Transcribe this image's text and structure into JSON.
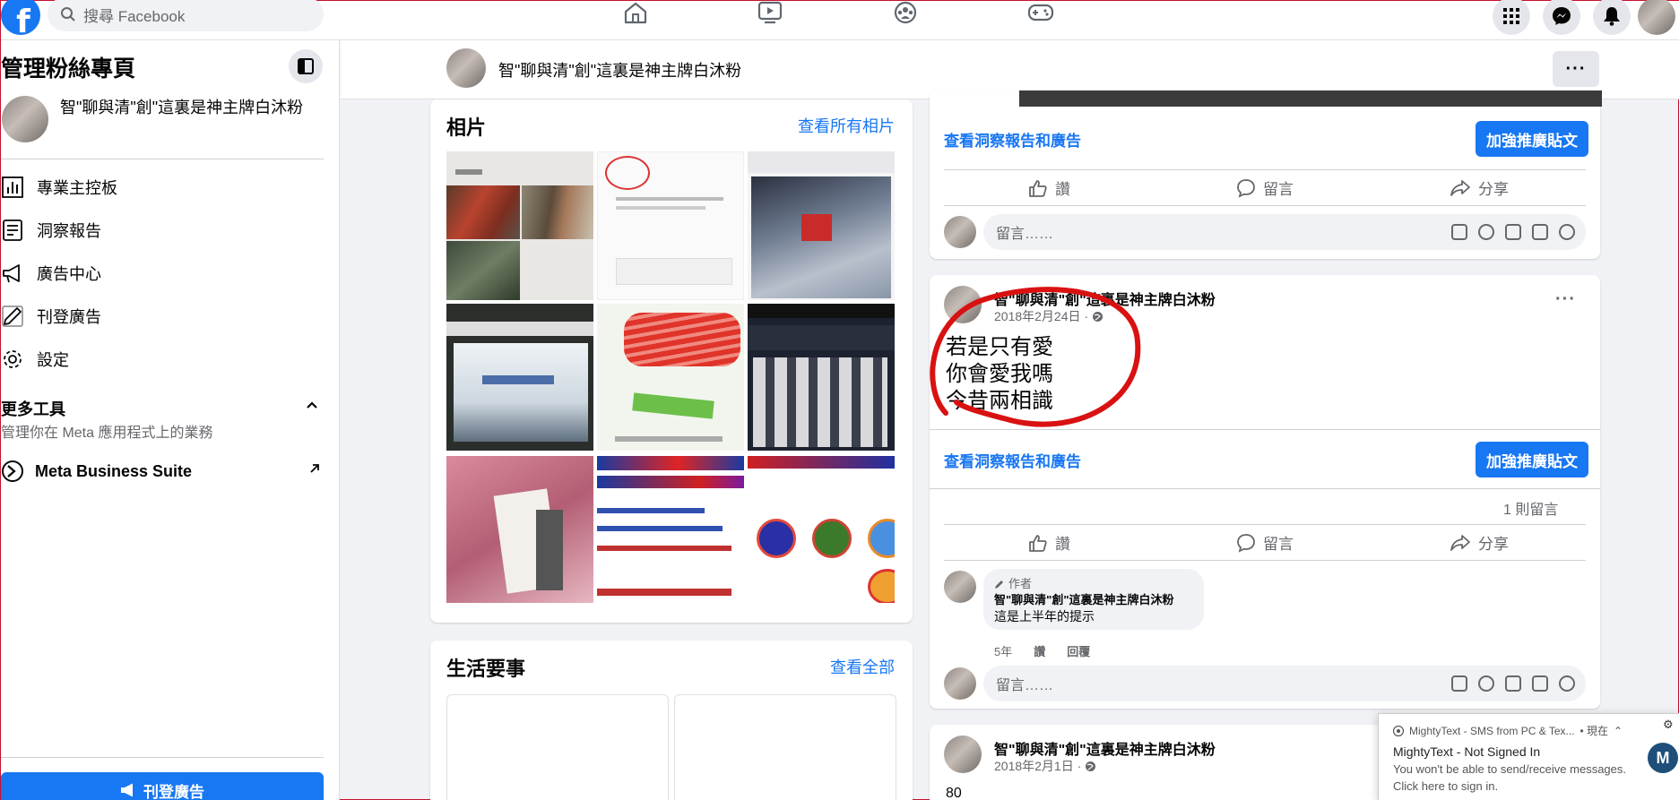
{
  "topbar": {
    "search_placeholder": "搜尋 Facebook"
  },
  "sidebar": {
    "title": "管理粉絲專頁",
    "page_name": "智\"聊與清\"創\"這裏是神主牌白沐粉",
    "items": [
      {
        "label": "專業主控板",
        "icon": "dashboard-icon"
      },
      {
        "label": "洞察報告",
        "icon": "insights-icon"
      },
      {
        "label": "廣告中心",
        "icon": "megaphone-icon"
      },
      {
        "label": "刊登廣告",
        "icon": "pencil-icon"
      },
      {
        "label": "設定",
        "icon": "gear-icon"
      }
    ],
    "more_tools": "更多工具",
    "more_tools_desc": "管理你在 Meta 應用程式上的業務",
    "meta_business_suite": "Meta Business Suite",
    "post_ad_button": "刊登廣告"
  },
  "page_header": {
    "name": "智\"聊與清\"創\"這裏是神主牌白沐粉",
    "more": "···"
  },
  "photos_card": {
    "title": "相片",
    "link": "查看所有相片"
  },
  "life_events_card": {
    "title": "生活要事",
    "link": "查看全部"
  },
  "post_actions": {
    "like": "讚",
    "comment": "留言",
    "share": "分享",
    "insights_link": "查看洞察報告和廣告",
    "boost_button": "加強推廣貼文",
    "comment_placeholder": "留言……"
  },
  "post1": {
    "author": "智\"聊與清\"創\"這裏是神主牌白沐粉",
    "date": "2018年2月24日 ·",
    "lines": [
      "若是只有愛",
      "你會愛我嗎",
      "今昔兩相識"
    ],
    "comment_count": "1 則留言",
    "comment": {
      "badge": "作者",
      "author": "智\"聊與清\"創\"這裏是神主牌白沐粉",
      "text": "這是上半年的提示",
      "time": "5年",
      "like": "讚",
      "reply": "回覆"
    }
  },
  "post2": {
    "author": "智\"聊與清\"創\"這裏是神主牌白沐粉",
    "date": "2018年2月1日 ·",
    "text": "80"
  },
  "popup": {
    "source": "MightyText - SMS from PC & Tex...",
    "time": "• 現在",
    "title": "MightyText - Not Signed In",
    "line1": "You won't be able to send/receive messages.",
    "line2": "Click here to sign in."
  }
}
